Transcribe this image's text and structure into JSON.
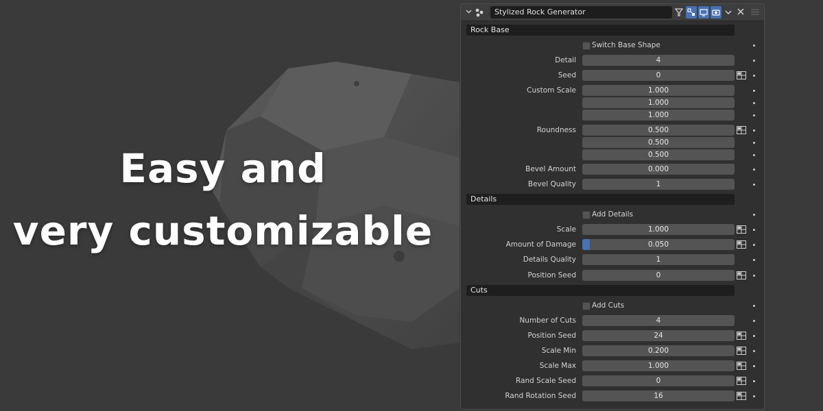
{
  "headline": {
    "line1": "Easy and",
    "line2": "very customizable"
  },
  "panel": {
    "title": "Stylized Rock Generator",
    "icons": [
      "chevron-down-icon",
      "node-group-icon",
      "funnel-icon",
      "select-icon",
      "viewport-icon",
      "camera-icon",
      "dropdown-icon",
      "close-icon",
      "drag-grip-icon"
    ]
  },
  "sections": [
    {
      "id": "rock-base",
      "label": "Rock Base"
    },
    {
      "id": "details",
      "label": "Details"
    },
    {
      "id": "cuts",
      "label": "Cuts"
    }
  ],
  "checkboxes": [
    {
      "id": "switch-base-shape",
      "label": "Switch Base Shape",
      "checked": false
    },
    {
      "id": "add-details",
      "label": "Add Details",
      "checked": false
    },
    {
      "id": "add-cuts",
      "label": "Add Cuts",
      "checked": false
    }
  ],
  "fields": {
    "detail": {
      "label": "Detail",
      "value": "4"
    },
    "seed": {
      "label": "Seed",
      "value": "0"
    },
    "custom_scale": {
      "label": "Custom Scale",
      "values": [
        "1.000",
        "1.000",
        "1.000"
      ]
    },
    "roundness": {
      "label": "Roundness",
      "values": [
        "0.500",
        "0.500",
        "0.500"
      ]
    },
    "bevel_amount": {
      "label": "Bevel Amount",
      "value": "0.000"
    },
    "bevel_quality": {
      "label": "Bevel Quality",
      "value": "1"
    },
    "scale": {
      "label": "Scale",
      "value": "1.000"
    },
    "amount_of_damage": {
      "label": "Amount of Damage",
      "value": "0.050",
      "fraction": 0.05
    },
    "details_quality": {
      "label": "Details Quality",
      "value": "1"
    },
    "details_position_seed": {
      "label": "Position Seed",
      "value": "0"
    },
    "number_of_cuts": {
      "label": "Number of Cuts",
      "value": "4"
    },
    "cuts_position_seed": {
      "label": "Position Seed",
      "value": "24"
    },
    "scale_min": {
      "label": "Scale Min",
      "value": "0.200"
    },
    "scale_max": {
      "label": "Scale Max",
      "value": "1.000"
    },
    "rand_scale_seed": {
      "label": "Rand Scale Seed",
      "value": "0"
    },
    "rand_rotation_seed": {
      "label": "Rand Rotation Seed",
      "value": "16"
    }
  },
  "colors": {
    "background": "#3a3a3a",
    "panel": "#303030",
    "field": "#545454",
    "section": "#1e1e1e",
    "accent": "#4772b3"
  }
}
